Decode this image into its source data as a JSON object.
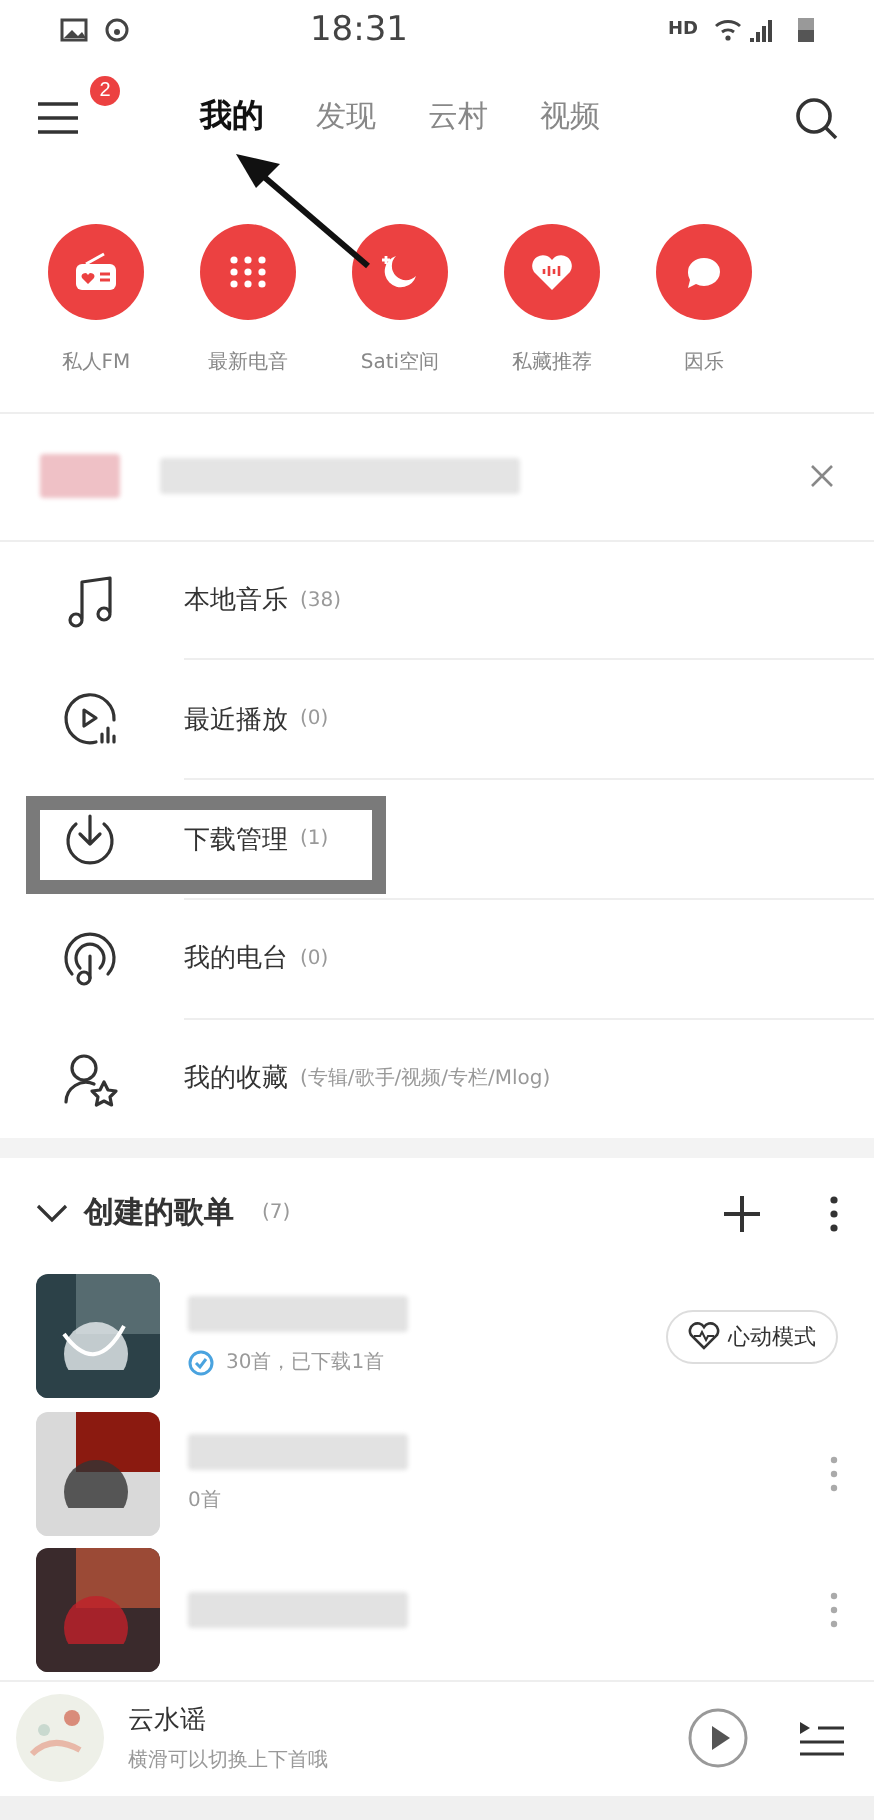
{
  "status_bar": {
    "time": "18:31",
    "network": "HD"
  },
  "header": {
    "menu_badge": "2",
    "tabs": [
      {
        "label": "我的",
        "selected": true
      },
      {
        "label": "发现",
        "selected": false
      },
      {
        "label": "云村",
        "selected": false
      },
      {
        "label": "视频",
        "selected": false
      }
    ]
  },
  "shortcuts": [
    {
      "label": "私人FM",
      "kind": "radio"
    },
    {
      "label": "最新电音",
      "kind": "dots"
    },
    {
      "label": "Sati空间",
      "kind": "moon"
    },
    {
      "label": "私藏推荐",
      "kind": "heart"
    },
    {
      "label": "因乐",
      "kind": "chat"
    }
  ],
  "menu": [
    {
      "label": "本地音乐",
      "count": "(38)",
      "kind": "music",
      "highlighted": false
    },
    {
      "label": "最近播放",
      "count": "(0)",
      "kind": "recent",
      "highlighted": false
    },
    {
      "label": "下载管理",
      "count": "(1)",
      "kind": "download",
      "highlighted": true
    },
    {
      "label": "我的电台",
      "count": "(0)",
      "kind": "podcast",
      "highlighted": false
    },
    {
      "label": "我的收藏",
      "count": "(专辑/歌手/视频/专栏/Mlog)",
      "kind": "favorite",
      "highlighted": false
    }
  ],
  "playlists_section": {
    "title": "创建的歌单",
    "count": "(7)",
    "expanded": true,
    "playlists": [
      {
        "subtitle": "30首，已下载1首",
        "downloaded": true,
        "action": "心动模式",
        "kind": "liked"
      },
      {
        "subtitle": "0首",
        "downloaded": false,
        "kind": "normal"
      },
      {
        "downloaded": false,
        "kind": "normal"
      }
    ]
  },
  "mini_player": {
    "title": "云水谣",
    "subtitle": "横滑可以切换上下首哦"
  }
}
